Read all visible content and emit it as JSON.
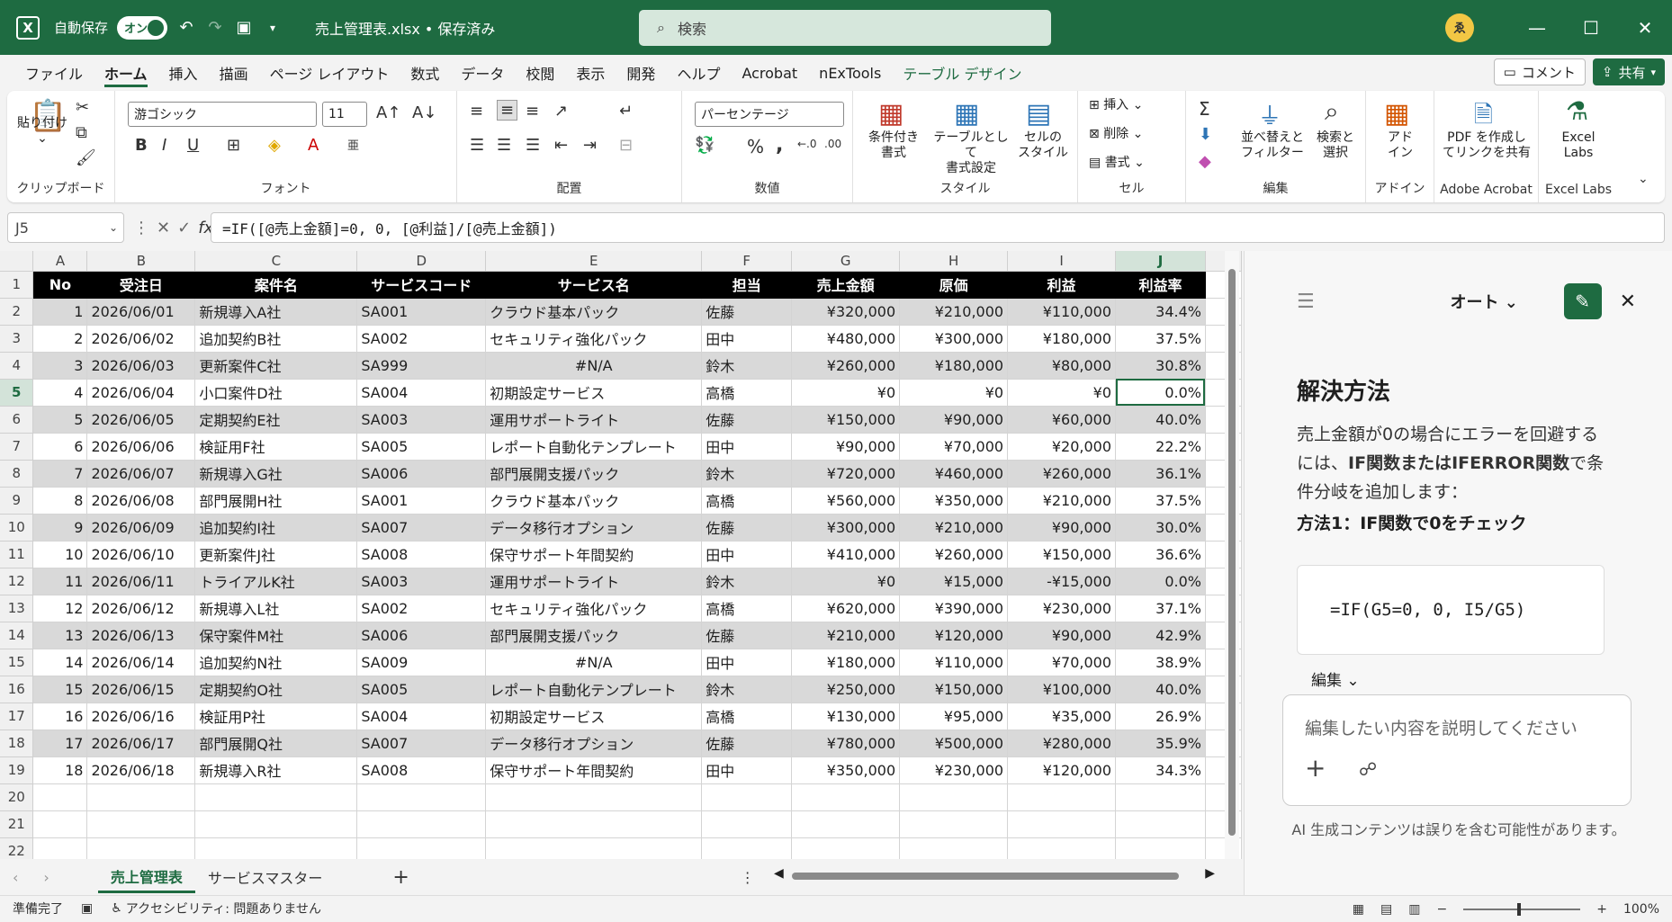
{
  "titlebar": {
    "logo": "X",
    "autosave_label": "自動保存",
    "autosave_toggle": "オン",
    "doc_title": "売上管理表.xlsx • 保存済み",
    "search_placeholder": "検索",
    "avatar": "ゑ"
  },
  "menu": {
    "tabs": [
      "ファイル",
      "ホーム",
      "挿入",
      "描画",
      "ページ レイアウト",
      "数式",
      "データ",
      "校閲",
      "表示",
      "開発",
      "ヘルプ",
      "Acrobat",
      "nExTools",
      "テーブル デザイン"
    ],
    "comment": "コメント",
    "share": "共有"
  },
  "ribbon": {
    "clipboard": {
      "label": "クリップボード",
      "paste": "貼り付け"
    },
    "font": {
      "label": "フォント",
      "name": "游ゴシック",
      "size": "11",
      "bold": "B",
      "italic": "I",
      "underline": "U"
    },
    "alignment": {
      "label": "配置"
    },
    "number": {
      "label": "数値",
      "format": "パーセンテージ",
      "percent": "%",
      "comma": ","
    },
    "styles": {
      "label": "スタイル",
      "conditional": "条件付き\n書式",
      "table": "テーブルとして\n書式設定",
      "cellstyle": "セルの\nスタイル"
    },
    "cells": {
      "label": "セル",
      "insert": "挿入",
      "delete": "削除",
      "format": "書式"
    },
    "editing": {
      "label": "編集",
      "sort": "並べ替えと\nフィルター",
      "find": "検索と\n選択"
    },
    "addins": {
      "label": "アドイン",
      "btn": "アド\nイン"
    },
    "acrobat": {
      "label": "Adobe Acrobat",
      "btn": "PDF を作成し\nてリンクを共有"
    },
    "excellabs": {
      "label": "Excel Labs",
      "btn": "Excel\nLabs"
    }
  },
  "formulabar": {
    "namebox": "J5",
    "formula": "=IF([@売上金額]=0, 0, [@利益]/[@売上金額])"
  },
  "sheet": {
    "col_letters": [
      "A",
      "B",
      "C",
      "D",
      "E",
      "F",
      "G",
      "H",
      "I",
      "J"
    ],
    "headers": [
      "No",
      "受注日",
      "案件名",
      "サービスコード",
      "サービス名",
      "担当",
      "売上金額",
      "原価",
      "利益",
      "利益率"
    ],
    "rows": [
      [
        "1",
        "2026/06/01",
        "新規導入A社",
        "SA001",
        "クラウド基本パック",
        "佐藤",
        "¥320,000",
        "¥210,000",
        "¥110,000",
        "34.4%"
      ],
      [
        "2",
        "2026/06/02",
        "追加契約B社",
        "SA002",
        "セキュリティ強化パック",
        "田中",
        "¥480,000",
        "¥300,000",
        "¥180,000",
        "37.5%"
      ],
      [
        "3",
        "2026/06/03",
        "更新案件C社",
        "SA999",
        "#N/A",
        "鈴木",
        "¥260,000",
        "¥180,000",
        "¥80,000",
        "30.8%"
      ],
      [
        "4",
        "2026/06/04",
        "小口案件D社",
        "SA004",
        "初期設定サービス",
        "高橋",
        "¥0",
        "¥0",
        "¥0",
        "0.0%"
      ],
      [
        "5",
        "2026/06/05",
        "定期契約E社",
        "SA003",
        "運用サポートライト",
        "佐藤",
        "¥150,000",
        "¥90,000",
        "¥60,000",
        "40.0%"
      ],
      [
        "6",
        "2026/06/06",
        "検証用F社",
        "SA005",
        "レポート自動化テンプレート",
        "田中",
        "¥90,000",
        "¥70,000",
        "¥20,000",
        "22.2%"
      ],
      [
        "7",
        "2026/06/07",
        "新規導入G社",
        "SA006",
        "部門展開支援パック",
        "鈴木",
        "¥720,000",
        "¥460,000",
        "¥260,000",
        "36.1%"
      ],
      [
        "8",
        "2026/06/08",
        "部門展開H社",
        "SA001",
        "クラウド基本パック",
        "高橋",
        "¥560,000",
        "¥350,000",
        "¥210,000",
        "37.5%"
      ],
      [
        "9",
        "2026/06/09",
        "追加契約I社",
        "SA007",
        "データ移行オプション",
        "佐藤",
        "¥300,000",
        "¥210,000",
        "¥90,000",
        "30.0%"
      ],
      [
        "10",
        "2026/06/10",
        "更新案件J社",
        "SA008",
        "保守サポート年間契約",
        "田中",
        "¥410,000",
        "¥260,000",
        "¥150,000",
        "36.6%"
      ],
      [
        "11",
        "2026/06/11",
        "トライアルK社",
        "SA003",
        "運用サポートライト",
        "鈴木",
        "¥0",
        "¥15,000",
        "-¥15,000",
        "0.0%"
      ],
      [
        "12",
        "2026/06/12",
        "新規導入L社",
        "SA002",
        "セキュリティ強化パック",
        "高橋",
        "¥620,000",
        "¥390,000",
        "¥230,000",
        "37.1%"
      ],
      [
        "13",
        "2026/06/13",
        "保守案件M社",
        "SA006",
        "部門展開支援パック",
        "佐藤",
        "¥210,000",
        "¥120,000",
        "¥90,000",
        "42.9%"
      ],
      [
        "14",
        "2026/06/14",
        "追加契約N社",
        "SA009",
        "#N/A",
        "田中",
        "¥180,000",
        "¥110,000",
        "¥70,000",
        "38.9%"
      ],
      [
        "15",
        "2026/06/15",
        "定期契約O社",
        "SA005",
        "レポート自動化テンプレート",
        "鈴木",
        "¥250,000",
        "¥150,000",
        "¥100,000",
        "40.0%"
      ],
      [
        "16",
        "2026/06/16",
        "検証用P社",
        "SA004",
        "初期設定サービス",
        "高橋",
        "¥130,000",
        "¥95,000",
        "¥35,000",
        "26.9%"
      ],
      [
        "17",
        "2026/06/17",
        "部門展開Q社",
        "SA007",
        "データ移行オプション",
        "佐藤",
        "¥780,000",
        "¥500,000",
        "¥280,000",
        "35.9%"
      ],
      [
        "18",
        "2026/06/18",
        "新規導入R社",
        "SA008",
        "保守サポート年間契約",
        "田中",
        "¥350,000",
        "¥230,000",
        "¥120,000",
        "34.3%"
      ]
    ],
    "empty_rows": [
      "20",
      "21",
      "22"
    ]
  },
  "sheettabs": {
    "tabs": [
      "売上管理表",
      "サービスマスター"
    ],
    "add": "+"
  },
  "copilot": {
    "mode": "オート",
    "heading": "解決方法",
    "desc_pre": "売上金額が0の場合にエラーを回避するには、",
    "desc_bold": "IF関数またはIFERROR関数",
    "desc_post": "で条件分岐を追加します：",
    "method1": "方法1：IF関数で0をチェック",
    "code": "=IF(G5=0, 0, I5/G5)",
    "edit_label": "編集",
    "input_placeholder": "編集したい内容を説明してください",
    "disclaimer": "AI 生成コンテンツは誤りを含む可能性があります。"
  },
  "statusbar": {
    "ready": "準備完了",
    "accessibility": "アクセシビリティ: 問題ありません",
    "zoom": "100%"
  },
  "colors": {
    "accent": "#1e6b41",
    "band": "#d9d9d9",
    "header": "#000000"
  }
}
